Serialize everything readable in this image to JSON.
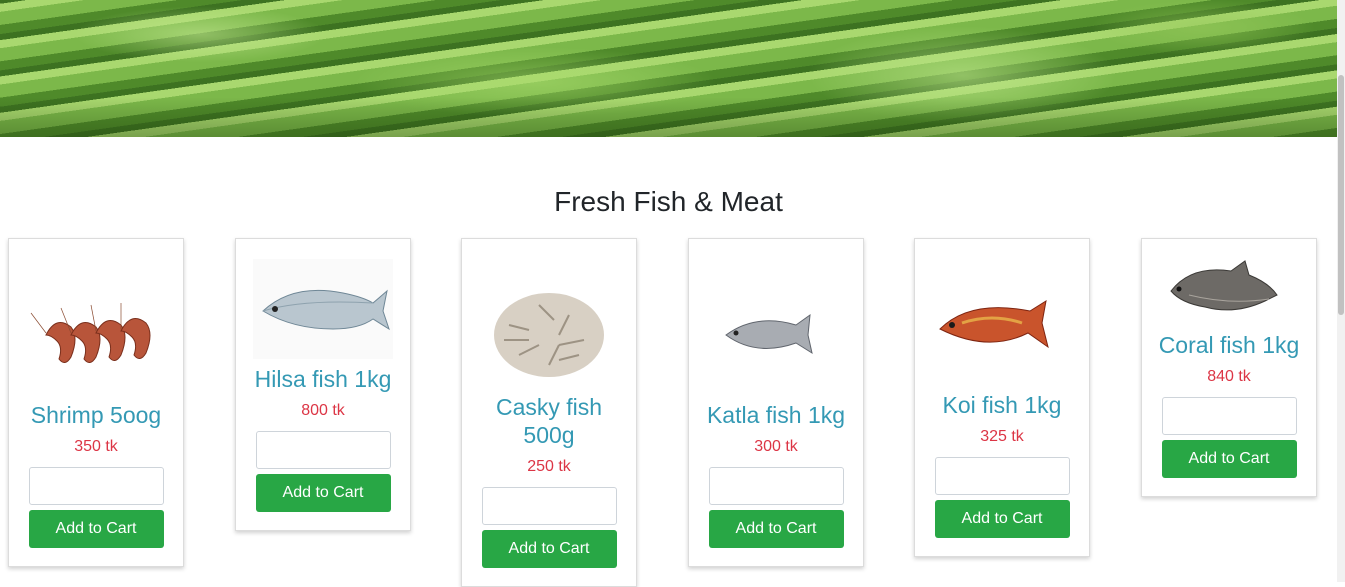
{
  "banner": {
    "alt": "green vegetables banner"
  },
  "section": {
    "title": "Fresh Fish & Meat"
  },
  "products": [
    {
      "name": "Shrimp 5oog",
      "price": "350 tk",
      "button": "Add to Cart",
      "icon": "shrimp-image"
    },
    {
      "name": "Hilsa fish 1kg",
      "price": "800 tk",
      "button": "Add to Cart",
      "icon": "hilsa-fish-image"
    },
    {
      "name": "Casky fish 500g",
      "price": "250 tk",
      "button": "Add to Cart",
      "icon": "casky-fish-image"
    },
    {
      "name": "Katla fish 1kg",
      "price": "300 tk",
      "button": "Add to Cart",
      "icon": "katla-fish-image"
    },
    {
      "name": "Koi fish 1kg",
      "price": "325 tk",
      "button": "Add to Cart",
      "icon": "koi-fish-image"
    },
    {
      "name": "Coral fish 1kg",
      "price": "840 tk",
      "button": "Add to Cart",
      "icon": "coral-fish-image"
    }
  ],
  "colors": {
    "accent": "#3499b4",
    "price": "#dc3545",
    "button": "#28a745"
  }
}
